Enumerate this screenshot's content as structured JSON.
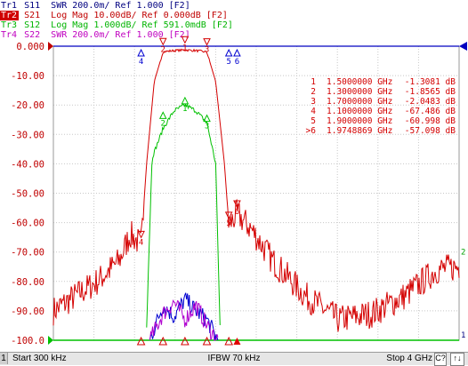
{
  "traces": [
    {
      "tag": "Tr1",
      "text": "S11  SWR 200.0m/ Ref 1.000 [F2]",
      "color": "#000080",
      "active": false
    },
    {
      "tag": "Tr2",
      "text": "S21  Log Mag 10.00dB/ Ref 0.000dB [F2]",
      "color": "#c00000",
      "active": true
    },
    {
      "tag": "Tr3",
      "text": "S12  Log Mag 1.000dB/ Ref 591.0mdB [F2]",
      "color": "#00b400",
      "active": false
    },
    {
      "tag": "Tr4",
      "text": "S22  SWR 200.0m/ Ref 1.000 [F2]",
      "color": "#c000c0",
      "active": false
    }
  ],
  "axis": {
    "y_ticks": [
      "0.000",
      "-10.00",
      "-20.00",
      "-30.00",
      "-40.00",
      "-50.00",
      "-60.00",
      "-70.00",
      "-80.00",
      "-90.00",
      "-100.0"
    ],
    "ref_marker_right": "2",
    "ref_marker_bottom_right": "1"
  },
  "marker_table": [
    {
      "id": "1",
      "freq": "1.5000000 GHz",
      "value": "-1.3081 dB"
    },
    {
      "id": "2",
      "freq": "1.3000000 GHz",
      "value": "-1.8565 dB"
    },
    {
      "id": "3",
      "freq": "1.7000000 GHz",
      "value": "-2.0483 dB"
    },
    {
      "id": "4",
      "freq": "1.1000000 GHz",
      "value": "-67.486 dB"
    },
    {
      "id": "5",
      "freq": "1.9000000 GHz",
      "value": "-60.998 dB"
    },
    {
      "id": ">6",
      "freq": "1.9748869 GHz",
      "value": "-57.098 dB"
    }
  ],
  "plot_markers": [
    "1",
    "2",
    "3",
    "4",
    "5",
    "6"
  ],
  "colors": {
    "s11": "#0000d0",
    "s21": "#d40000",
    "s12": "#00c000",
    "s22": "#b000d0",
    "grid": "#c8c8c8",
    "axis_text": "#c00000",
    "status_bg": "#e6e6e6"
  },
  "chart_data": {
    "type": "line",
    "x_range_ghz": [
      0.3,
      4.0
    ],
    "series": [
      {
        "name": "S21",
        "points": [
          [
            0.3,
            -90
          ],
          [
            0.5,
            -85
          ],
          [
            0.7,
            -80
          ],
          [
            0.9,
            -73
          ],
          [
            1.0,
            -64
          ],
          [
            1.1,
            -67.5
          ],
          [
            1.15,
            -40
          ],
          [
            1.22,
            -12
          ],
          [
            1.3,
            -1.9
          ],
          [
            1.4,
            -1.5
          ],
          [
            1.5,
            -1.3
          ],
          [
            1.6,
            -1.5
          ],
          [
            1.7,
            -2.0
          ],
          [
            1.78,
            -12
          ],
          [
            1.86,
            -40
          ],
          [
            1.9,
            -61
          ],
          [
            1.975,
            -57.1
          ],
          [
            2.1,
            -62
          ],
          [
            2.3,
            -73
          ],
          [
            2.6,
            -85
          ],
          [
            2.9,
            -93
          ],
          [
            3.2,
            -91
          ],
          [
            3.5,
            -85
          ],
          [
            3.8,
            -76
          ],
          [
            4.0,
            -75
          ]
        ]
      },
      {
        "name": "S12",
        "points": [
          [
            1.15,
            -95
          ],
          [
            1.2,
            -38
          ],
          [
            1.3,
            -28
          ],
          [
            1.4,
            -22
          ],
          [
            1.5,
            -20
          ],
          [
            1.6,
            -22
          ],
          [
            1.7,
            -26
          ],
          [
            1.78,
            -40
          ],
          [
            1.82,
            -95
          ]
        ]
      },
      {
        "name": "S11",
        "points": [
          [
            1.18,
            -100
          ],
          [
            1.3,
            -88
          ],
          [
            1.4,
            -92
          ],
          [
            1.5,
            -86
          ],
          [
            1.6,
            -90
          ],
          [
            1.7,
            -93
          ],
          [
            1.8,
            -100
          ]
        ]
      },
      {
        "name": "S22",
        "points": [
          [
            1.18,
            -100
          ],
          [
            1.3,
            -91
          ],
          [
            1.4,
            -87
          ],
          [
            1.5,
            -93
          ],
          [
            1.6,
            -88
          ],
          [
            1.7,
            -95
          ],
          [
            1.8,
            -100
          ]
        ]
      }
    ],
    "ylim": [
      -100,
      0
    ]
  },
  "status": {
    "channel": "1",
    "start": "Start 300 kHz",
    "ifbw": "IFBW 70 kHz",
    "stop": "Stop 4 GHz",
    "cal": "C?",
    "update": "↑↓"
  }
}
